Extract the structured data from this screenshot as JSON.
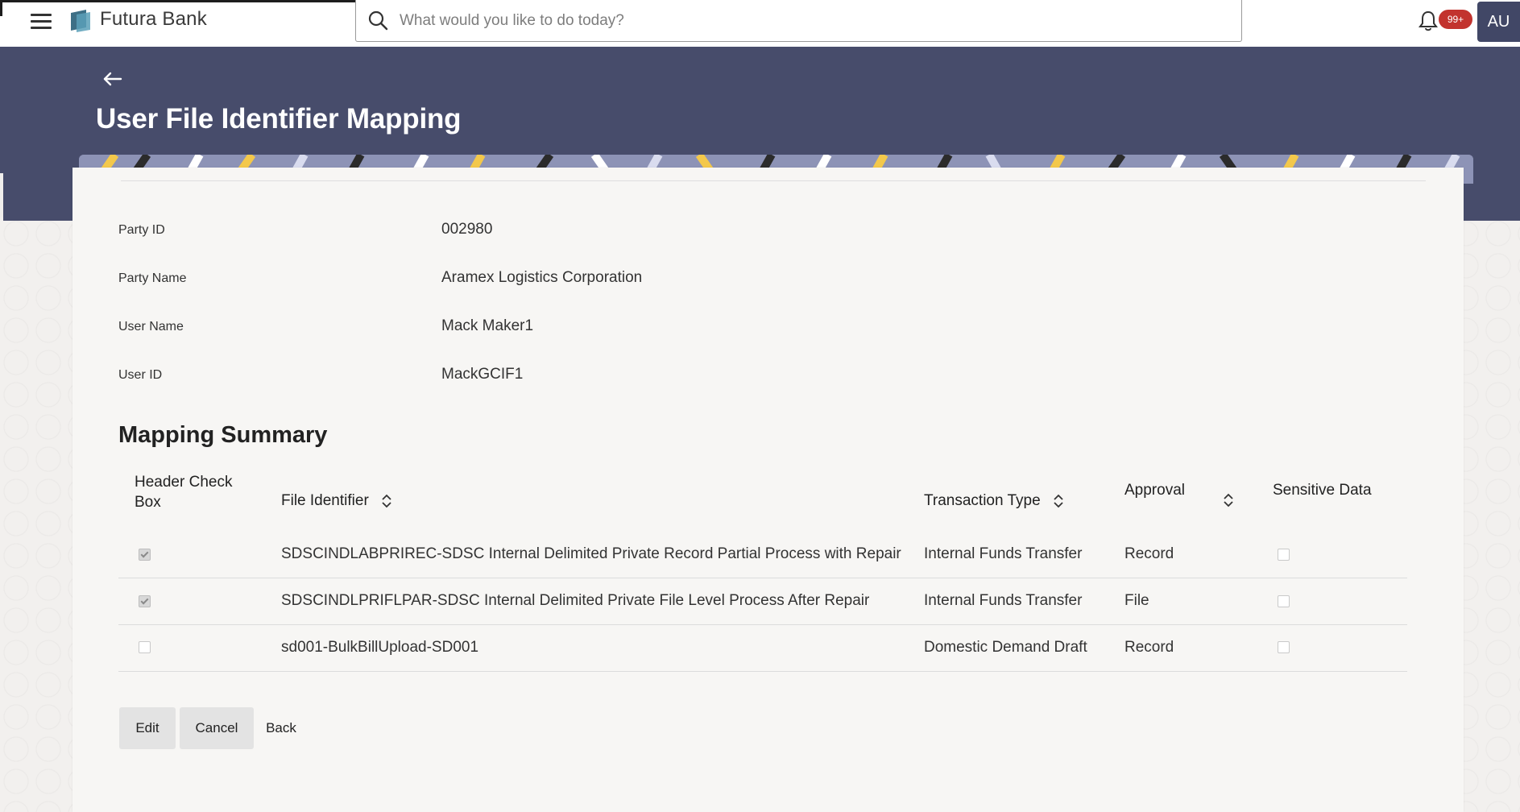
{
  "header": {
    "brand": "Futura Bank",
    "search_placeholder": "What would you like to do today?",
    "notification_count": "99+",
    "avatar_initials": "AU"
  },
  "page": {
    "title": "User File Identifier Mapping"
  },
  "details": [
    {
      "label": "Party ID",
      "value": "002980"
    },
    {
      "label": "Party Name",
      "value": "Aramex Logistics Corporation"
    },
    {
      "label": "User Name",
      "value": "Mack Maker1"
    },
    {
      "label": "User ID",
      "value": "MackGCIF1"
    }
  ],
  "summary": {
    "title": "Mapping Summary",
    "columns": {
      "header_check_line1": "Header Check",
      "header_check_line2": "Box",
      "file_identifier": "File Identifier",
      "transaction_type": "Transaction Type",
      "approval": "Approval",
      "sensitive": "Sensitive Data"
    },
    "rows": [
      {
        "checked": true,
        "file_identifier": "SDSCINDLABPRIREC-SDSC Internal Delimited Private Record Partial Process with Repair",
        "transaction_type": "Internal Funds Transfer",
        "approval": "Record",
        "sensitive": false
      },
      {
        "checked": true,
        "file_identifier": "SDSCINDLPRIFLPAR-SDSC Internal Delimited Private File Level Process After Repair",
        "transaction_type": "Internal Funds Transfer",
        "approval": "File",
        "sensitive": false
      },
      {
        "checked": false,
        "file_identifier": "sd001-BulkBillUpload-SD001",
        "transaction_type": "Domestic Demand Draft",
        "approval": "Record",
        "sensitive": false
      }
    ]
  },
  "actions": {
    "edit": "Edit",
    "cancel": "Cancel",
    "back": "Back"
  },
  "colors": {
    "banner": "#474c6b",
    "badge": "#c2332e",
    "avatar": "#414766"
  }
}
